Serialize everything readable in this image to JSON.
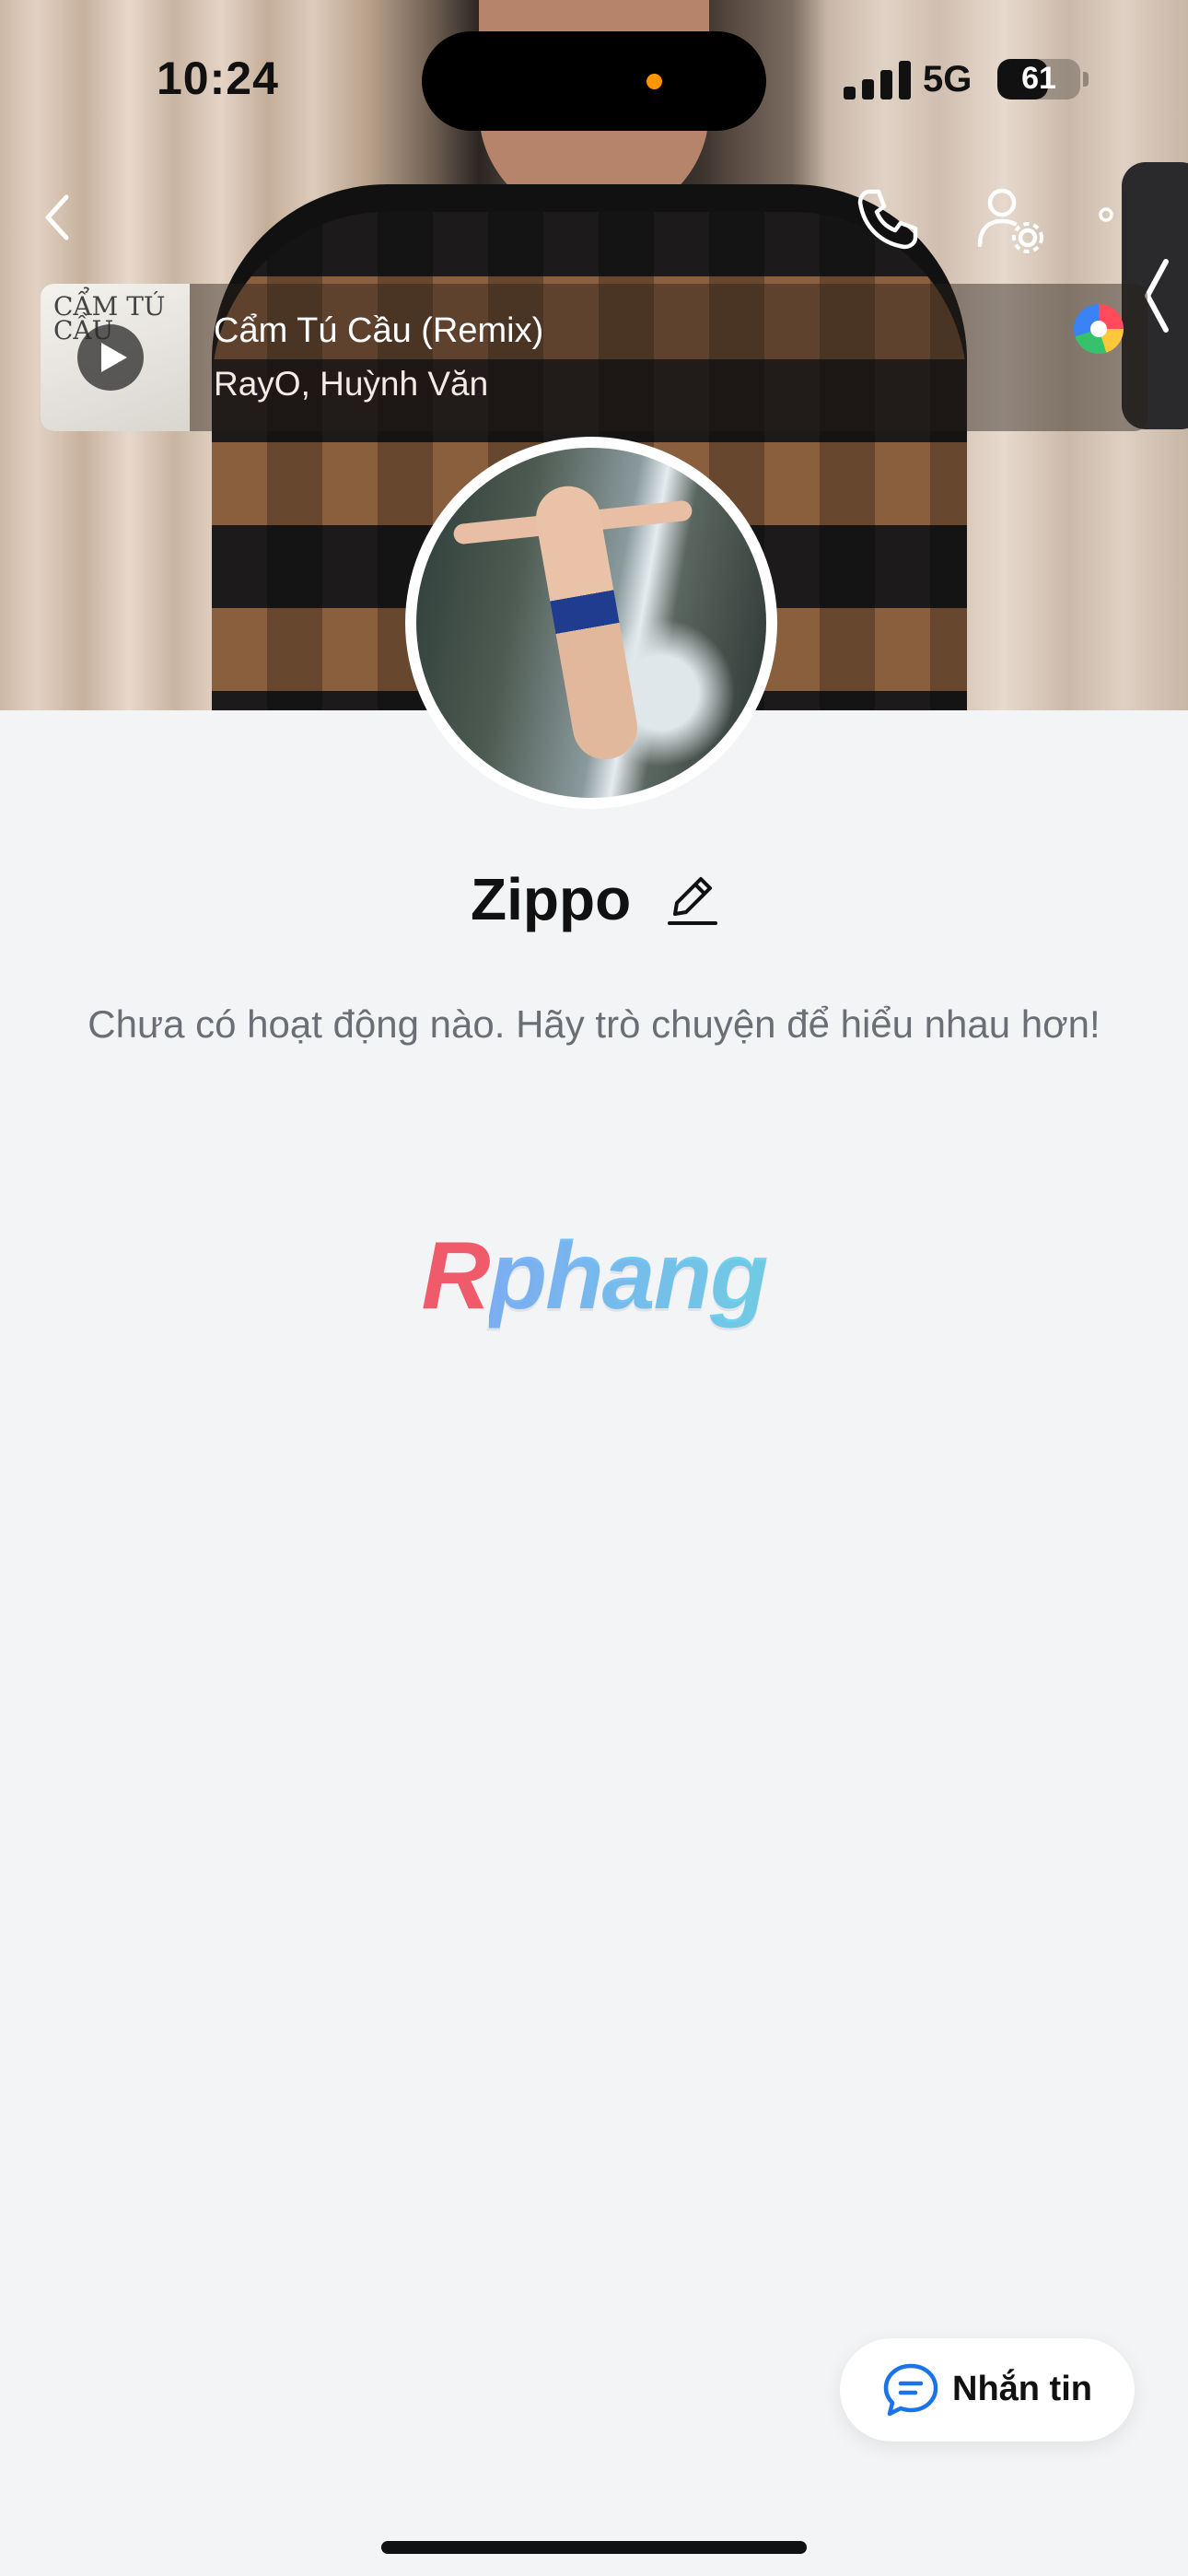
{
  "status_bar": {
    "time": "10:24",
    "network": "5G",
    "battery": "61",
    "battery_level": 0.61
  },
  "header": {
    "back_icon": "chevron-left-icon",
    "call_icon": "phone-icon",
    "settings_icon": "user-settings-icon",
    "more_icon": "more-icon"
  },
  "music": {
    "album_text": "CẨM TÚ CẦU",
    "title": "Cẩm Tú Cầu (Remix)",
    "artist": "RayO, Huỳnh Văn"
  },
  "profile": {
    "name": "Zippo",
    "empty_message": "Chưa có hoạt động nào. Hãy trò chuyện để hiểu nhau hơn!"
  },
  "watermark": {
    "first": "R",
    "rest": "phang"
  },
  "actions": {
    "message_label": "Nhắn tin"
  },
  "colors": {
    "background": "#f3f4f6",
    "accent": "#1a73e8"
  }
}
